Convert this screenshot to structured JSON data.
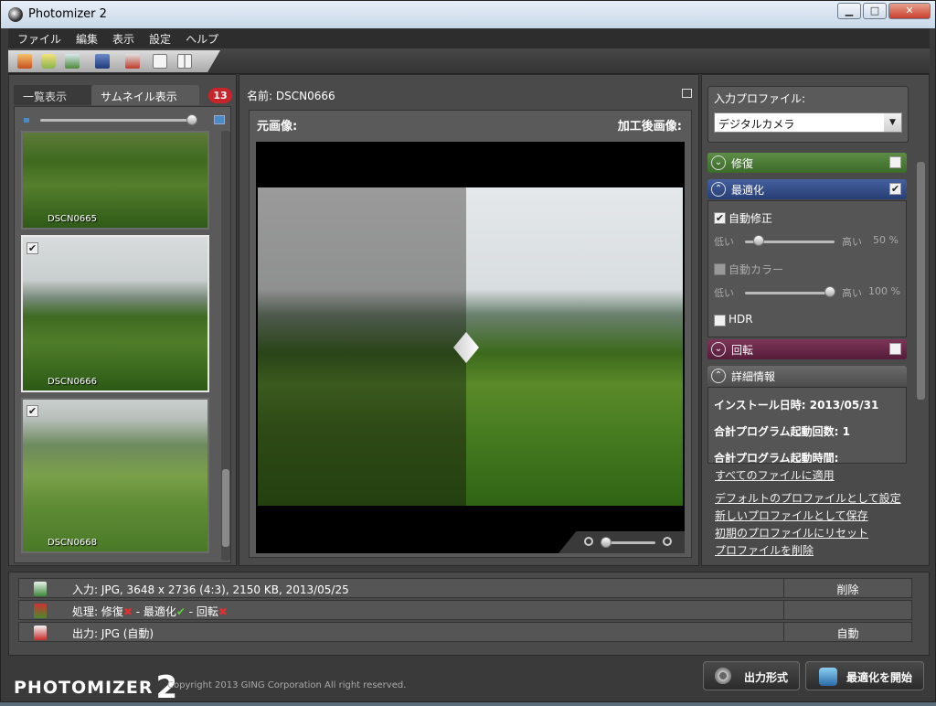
{
  "window": {
    "title": "Photomizer 2",
    "min_symbol": "▁",
    "max_symbol": "□",
    "close_symbol": "✕"
  },
  "menu": [
    "ファイル",
    "編集",
    "表示",
    "設定",
    "ヘルプ"
  ],
  "toolbar_icons": [
    "open-image-icon",
    "open-folder-icon",
    "refresh-icon",
    "save-icon",
    "remove-icon",
    "single-view-icon",
    "split-view-icon"
  ],
  "left": {
    "tabs": [
      "一覧表示",
      "サムネイル表示"
    ],
    "badge": "13",
    "thumbnails": [
      {
        "name": "DSCN0665",
        "checked": false
      },
      {
        "name": "DSCN0666",
        "checked": true
      },
      {
        "name": "DSCN0668",
        "checked": true
      }
    ]
  },
  "center": {
    "name_label": "名前: DSCN0666",
    "original_label": "元画像:",
    "processed_label": "加工後画像:"
  },
  "right": {
    "profile_label": "入力プロファイル:",
    "profile_value": "デジタルカメラ",
    "sections": {
      "repair": {
        "label": "修復",
        "checked": false,
        "color": "#4e7a3c"
      },
      "optimize": {
        "label": "最適化",
        "checked": true,
        "color": "#2f4680"
      },
      "rotate": {
        "label": "回転",
        "checked": false,
        "color": "#6a2a4a"
      },
      "details": {
        "label": "詳細情報"
      }
    },
    "auto_correct": {
      "label": "自動修正",
      "checked": true,
      "low": "低い",
      "high": "高い",
      "value_text": "50 %",
      "value": 0.5
    },
    "auto_color": {
      "label": "自動カラー",
      "checked": false,
      "low": "低い",
      "high": "高い",
      "value_text": "100 %",
      "value": 1.0
    },
    "hdr": {
      "label": "HDR",
      "checked": false
    },
    "details": {
      "install_date": "インストール日時: 2013/05/31",
      "launch_count": "合計プログラム起動回数: 1",
      "launch_time": "合計プログラム起動時間:"
    },
    "links": [
      "すべてのファイルに適用",
      "デフォルトのプロファイルとして設定",
      "新しいプロファイルとして保存",
      "初期のプロファイルにリセット",
      "プロファイルを削除"
    ]
  },
  "info": {
    "input": {
      "text": "入力: JPG, 3648 x 2736 (4:3), 2150 KB, 2013/05/25",
      "button": "削除"
    },
    "process": {
      "prefix": "処理: 修復",
      "part2": " - 最適化",
      "part3": " - 回転",
      "x_mark": "✖",
      "check_mark": "✔"
    },
    "output": {
      "text": "出力: JPG (自動)",
      "button": "自動"
    }
  },
  "footer": {
    "logo": "PHOTOMIZER",
    "logo_num": "2",
    "copyright": "Copyright 2013 GING Corporation All right reserved.",
    "format_button": "出力形式",
    "start_button": "最適化を開始"
  }
}
